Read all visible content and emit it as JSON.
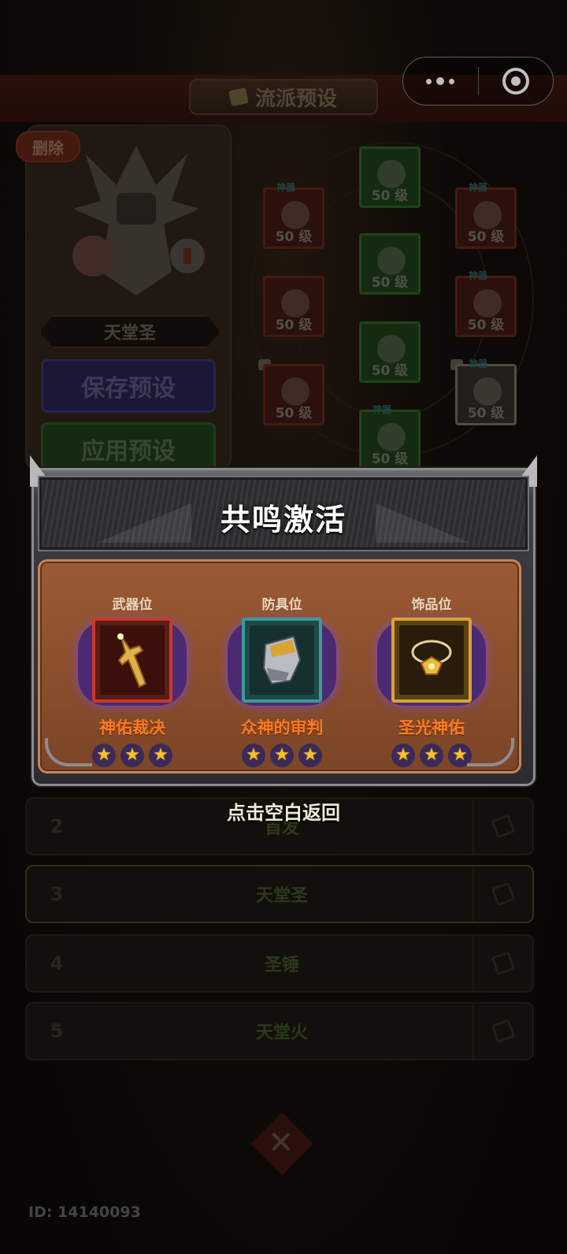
{
  "topbar": {
    "title": "流派预设"
  },
  "left_panel": {
    "delete_label": "删除",
    "hero_name": "天堂圣",
    "save_label": "保存预设",
    "apply_label": "应用预设"
  },
  "slots": {
    "level_label": "50 级",
    "tag": "神器"
  },
  "preset_rows": [
    {
      "num": "2",
      "name": "首发"
    },
    {
      "num": "3",
      "name": "天堂圣"
    },
    {
      "num": "4",
      "name": "圣锤"
    },
    {
      "num": "5",
      "name": "天堂火"
    }
  ],
  "modal": {
    "title": "共鸣激活",
    "items": [
      {
        "position": "武器位",
        "name": "神佑裁决",
        "stars": 3,
        "frame_color": "#c93a2a",
        "icon": "sword-icon"
      },
      {
        "position": "防具位",
        "name": "众神的审判",
        "stars": 3,
        "frame_color": "#3d9a94",
        "icon": "gauntlet-icon"
      },
      {
        "position": "饰品位",
        "name": "圣光神佑",
        "stars": 3,
        "frame_color": "#d9a432",
        "icon": "amulet-icon"
      }
    ],
    "star_glyph": "★",
    "hint": "点击空白返回"
  },
  "user": {
    "id_text": "ID: 14140093"
  }
}
